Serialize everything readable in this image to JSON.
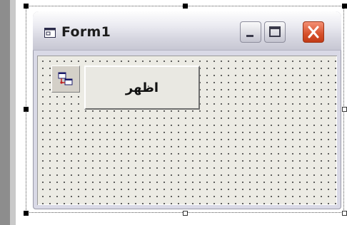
{
  "form": {
    "title": "Form1"
  },
  "controls": {
    "show_button_label": "اظهر"
  },
  "icons": {
    "title": "form-icon",
    "tool": "component-icon",
    "minimize": "minimize-icon",
    "maximize": "maximize-icon",
    "close": "close-icon"
  },
  "colors": {
    "close_button": "#d6502b",
    "client_background": "#ecebe4"
  }
}
